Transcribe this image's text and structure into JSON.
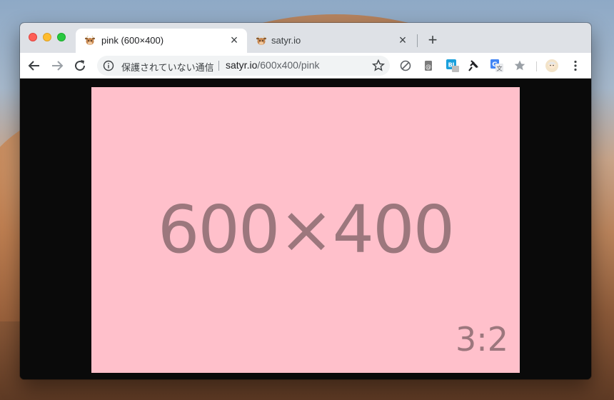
{
  "browser": {
    "tabs": [
      {
        "title": "pink (600×400)",
        "active": true,
        "favicon": "cow-favicon-icon"
      },
      {
        "title": "satyr.io",
        "active": false,
        "favicon": "cow-favicon-icon"
      }
    ],
    "new_tab_label": "+",
    "close_label": "×"
  },
  "toolbar": {
    "security_text": "保護されていない通信",
    "url_host": "satyr.io",
    "url_path": "/600x400/pink",
    "extensions": [
      "block-icon",
      "clip-icon",
      "bl-extension-icon",
      "pin-icon",
      "translate-icon",
      "star-extension-icon",
      "avatar"
    ]
  },
  "page": {
    "size_label": "600×400",
    "ratio_label": "3:2",
    "background_color": "#ffc0cb",
    "text_color": "#9c777d"
  }
}
